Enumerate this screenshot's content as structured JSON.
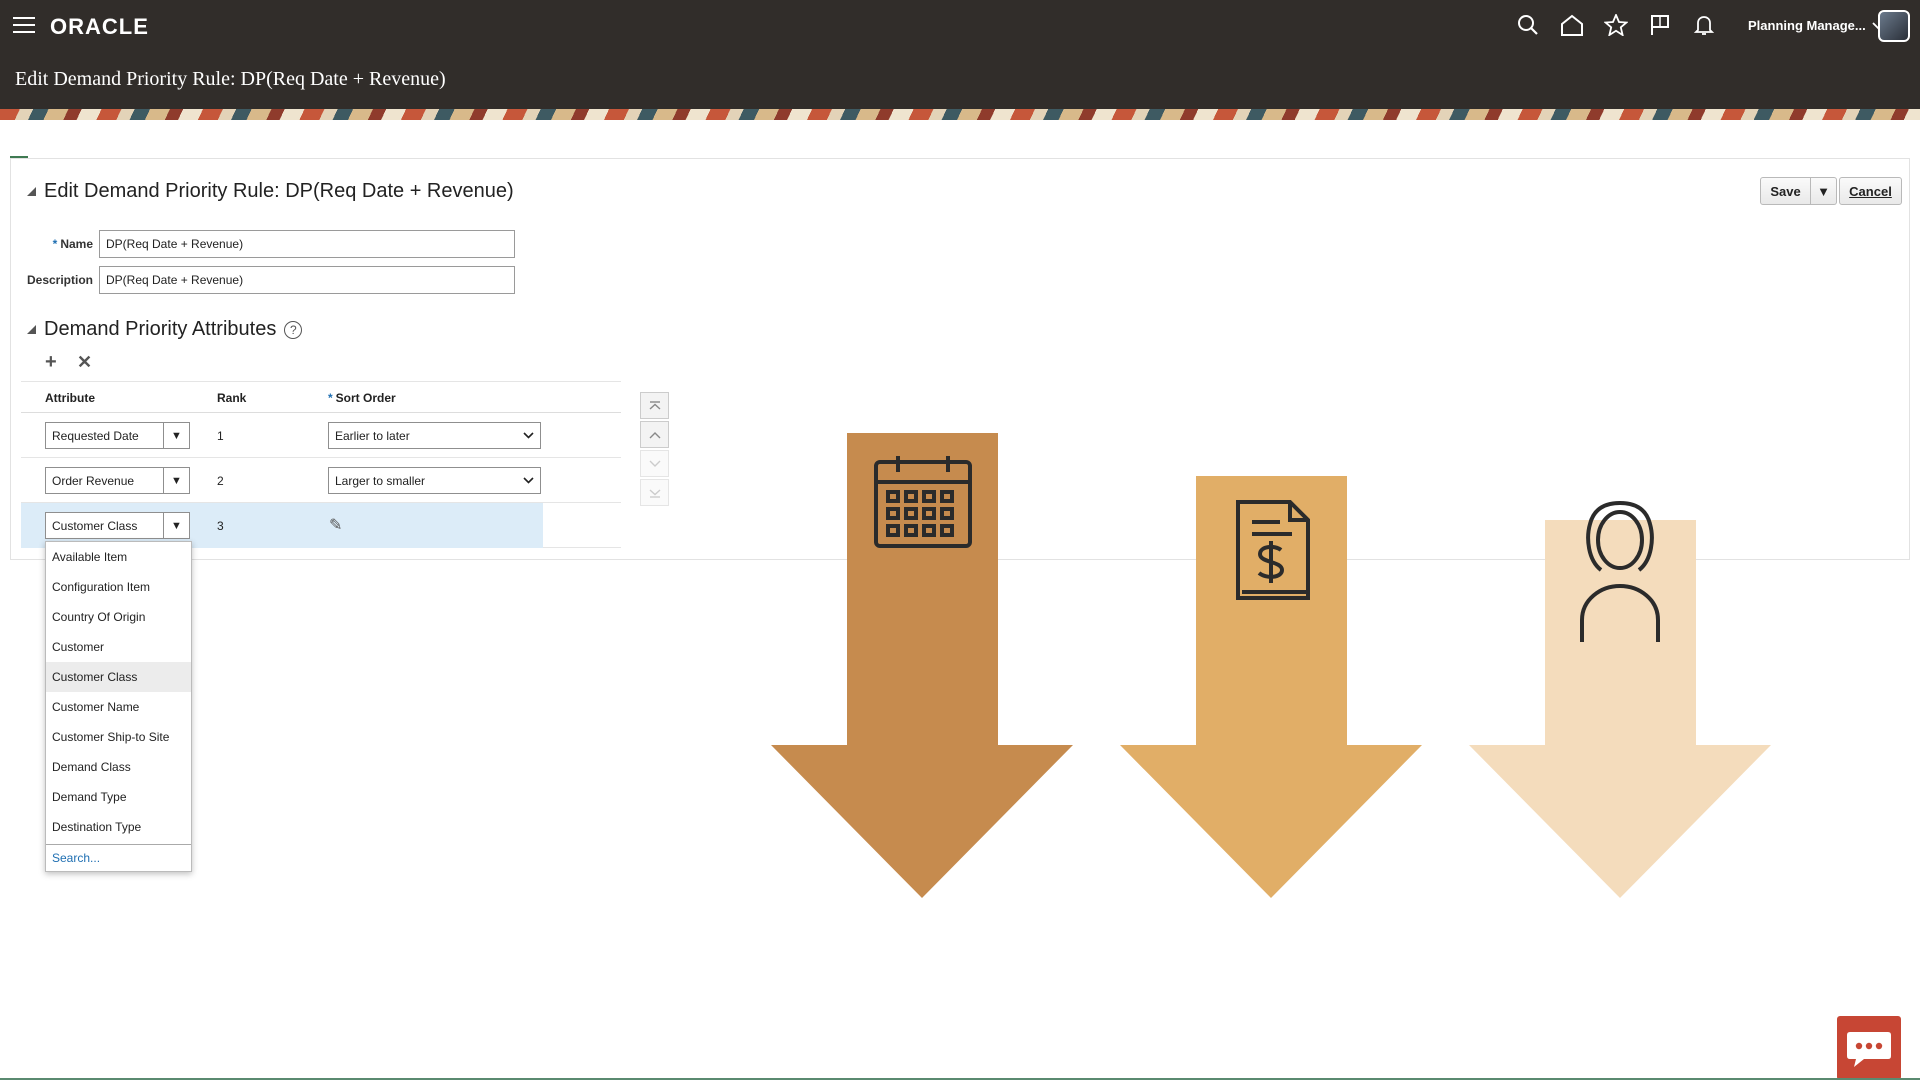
{
  "app": {
    "logo_text": "ORACLE",
    "page_title": "Edit Demand Priority Rule: DP(Req Date + Revenue)",
    "user_menu_label": "Planning Manage...",
    "header_icons": [
      "search-icon",
      "home-icon",
      "star-icon",
      "flag-icon",
      "bell-icon"
    ]
  },
  "form": {
    "section_title": "Edit Demand Priority Rule: DP(Req Date + Revenue)",
    "save_label": "Save",
    "cancel_label": "Cancel",
    "name_label": "Name",
    "name_value": "DP(Req Date + Revenue)",
    "description_label": "Description",
    "description_value": "DP(Req Date + Revenue)",
    "required_marker": "*"
  },
  "attributes": {
    "section_title": "Demand Priority Attributes",
    "help_glyph": "?",
    "columns": {
      "attribute": "Attribute",
      "rank": "Rank",
      "sort_order": "Sort Order"
    },
    "rows": [
      {
        "attribute": "Requested Date",
        "rank": "1",
        "sort_order": "Earlier to later"
      },
      {
        "attribute": "Order Revenue",
        "rank": "2",
        "sort_order": "Larger to smaller"
      },
      {
        "attribute": "Customer Class",
        "rank": "3",
        "sort_order": ""
      }
    ]
  },
  "dropdown": {
    "items": [
      "Available Item",
      "Configuration Item",
      "Country Of Origin",
      "Customer",
      "Customer Class",
      "Customer Name",
      "Customer Ship-to Site",
      "Demand Class",
      "Demand Type",
      "Destination Type"
    ],
    "selected_index": 4,
    "search_label": "Search..."
  },
  "illustration": {
    "arrows": [
      {
        "icon": "calendar-icon",
        "color": "#c68b4e"
      },
      {
        "icon": "invoice-dollar-icon",
        "color": "#e1ae67"
      },
      {
        "icon": "person-icon",
        "color": "#f4dcbc"
      }
    ]
  },
  "colors": {
    "header_bg": "#312d2a",
    "selected_row": "#dcecf8",
    "link": "#1f6fb2",
    "chat_button": "#c74634"
  }
}
